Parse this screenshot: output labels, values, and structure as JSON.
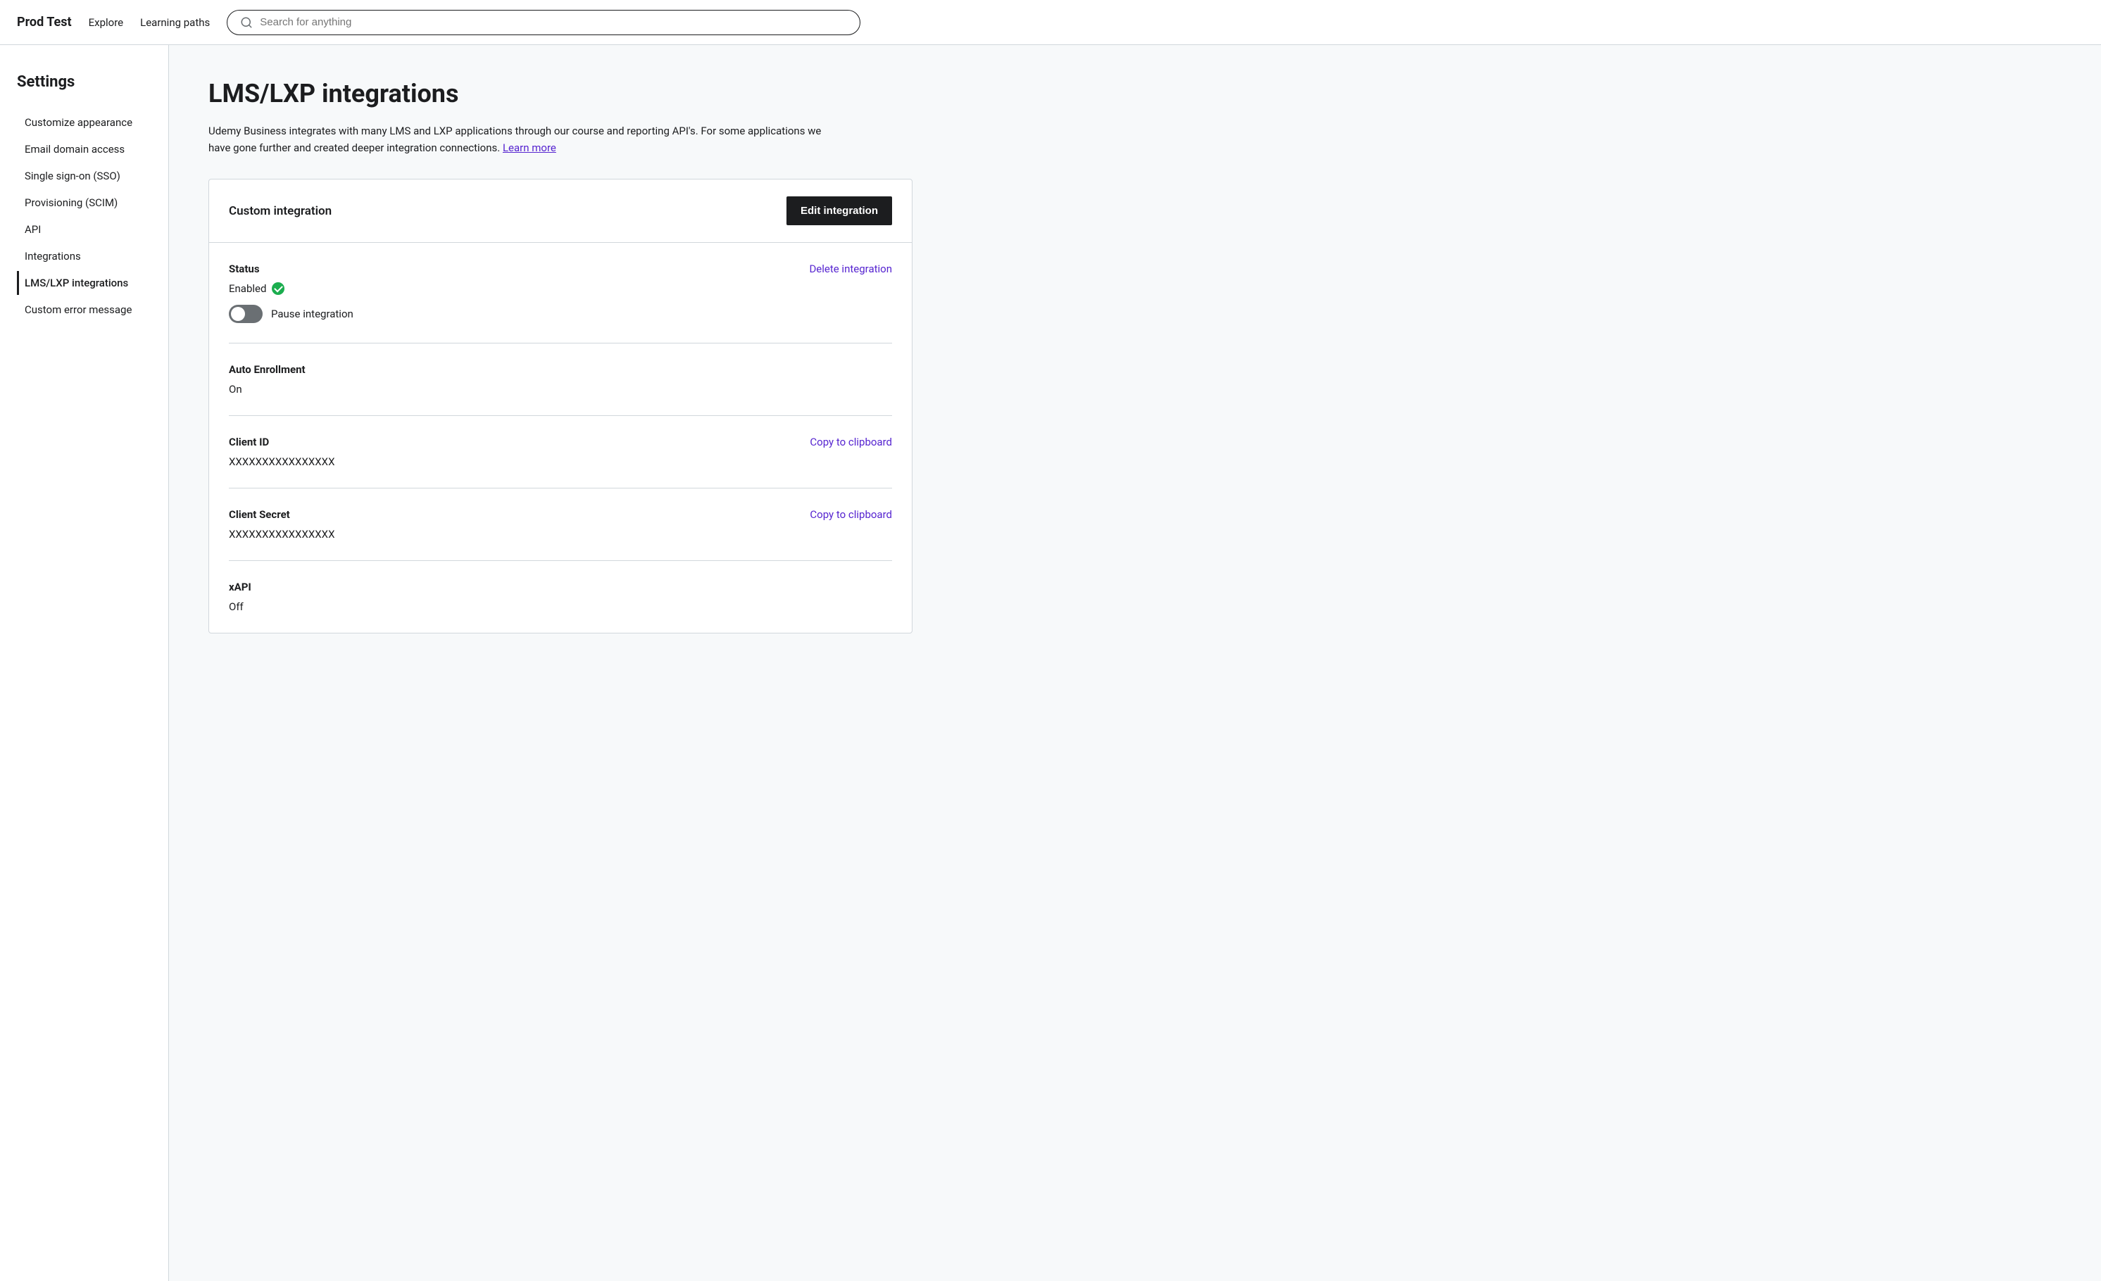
{
  "nav": {
    "brand": "Prod Test",
    "links": [
      "Explore",
      "Learning paths"
    ],
    "search_placeholder": "Search for anything"
  },
  "sidebar": {
    "title": "Settings",
    "items": [
      {
        "id": "customize-appearance",
        "label": "Customize appearance",
        "active": false
      },
      {
        "id": "email-domain-access",
        "label": "Email domain access",
        "active": false
      },
      {
        "id": "single-sign-on",
        "label": "Single sign-on (SSO)",
        "active": false
      },
      {
        "id": "provisioning-scim",
        "label": "Provisioning (SCIM)",
        "active": false
      },
      {
        "id": "api",
        "label": "API",
        "active": false
      },
      {
        "id": "integrations",
        "label": "Integrations",
        "active": false
      },
      {
        "id": "lms-lxp-integrations",
        "label": "LMS/LXP integrations",
        "active": true
      },
      {
        "id": "custom-error-message",
        "label": "Custom error message",
        "active": false
      }
    ]
  },
  "main": {
    "page_title": "LMS/LXP integrations",
    "description": "Udemy Business integrates with many LMS and LXP applications through our course and reporting API's. For some applications we have gone further and created deeper integration connections.",
    "learn_more_text": "Learn more",
    "card": {
      "title": "Custom integration",
      "edit_btn_label": "Edit integration",
      "sections": {
        "status": {
          "label": "Status",
          "enabled_text": "Enabled",
          "pause_label": "Pause integration",
          "delete_link": "Delete integration"
        },
        "auto_enrollment": {
          "label": "Auto Enrollment",
          "value": "On"
        },
        "client_id": {
          "label": "Client ID",
          "value": "XXXXXXXXXXXXXXXX",
          "copy_label": "Copy to clipboard"
        },
        "client_secret": {
          "label": "Client Secret",
          "value": "XXXXXXXXXXXXXXXX",
          "copy_label": "Copy to clipboard"
        },
        "xapi": {
          "label": "xAPI",
          "value": "Off"
        }
      }
    }
  }
}
